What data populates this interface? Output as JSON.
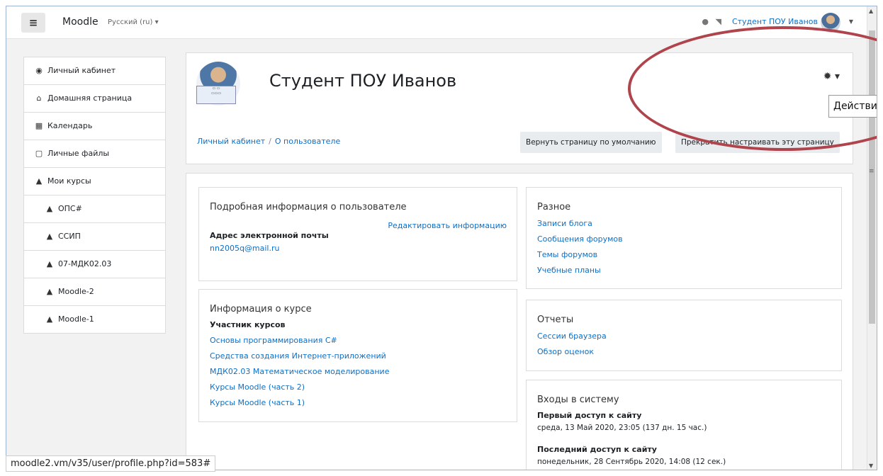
{
  "navbar": {
    "brand": "Moodle",
    "language": "Русский (ru) ▾",
    "user_name": "Студент ПОУ Иванов",
    "menu_icon": "hamburger-icon",
    "bell_icon": "bell-icon",
    "message_icon": "message-icon"
  },
  "drawer": {
    "items": [
      {
        "label": "Личный кабинет",
        "icon": "dashboard-icon",
        "glyph": "◉"
      },
      {
        "label": "Домашняя страница",
        "icon": "home-icon",
        "glyph": "⌂"
      },
      {
        "label": "Календарь",
        "icon": "calendar-icon",
        "glyph": "▦"
      },
      {
        "label": "Личные файлы",
        "icon": "file-icon",
        "glyph": "▢"
      },
      {
        "label": "Мои курсы",
        "icon": "graduation-cap-icon",
        "glyph": "▲"
      },
      {
        "label": "ОПС#",
        "icon": "graduation-cap-icon",
        "glyph": "▲"
      },
      {
        "label": "ССИП",
        "icon": "graduation-cap-icon",
        "glyph": "▲"
      },
      {
        "label": "07-МДК02.03",
        "icon": "graduation-cap-icon",
        "glyph": "▲"
      },
      {
        "label": "Moodle-2",
        "icon": "graduation-cap-icon",
        "glyph": "▲"
      },
      {
        "label": "Moodle-1",
        "icon": "graduation-cap-icon",
        "glyph": "▲"
      }
    ]
  },
  "header": {
    "full_name": "Студент ПОУ Иванов",
    "breadcrumb": [
      "Личный кабинет",
      "О пользователе"
    ],
    "reset_button": "Вернуть страницу по умолчанию",
    "stop_button": "Прекратить настраивать эту страницу",
    "actions_tooltip": "Действия"
  },
  "details": {
    "title": "Подробная информация о пользователе",
    "edit_link": "Редактировать информацию",
    "email_label": "Адрес электронной почты",
    "email": "nn2005q@mail.ru"
  },
  "courses": {
    "title": "Информация о курсе",
    "participant_label": "Участник курсов",
    "items": [
      "Основы программирования С#",
      "Средства создания Интернет-приложений",
      "МДК02.03 Математическое моделирование",
      "Курсы Moodle (часть 2)",
      "Курсы Moodle (часть 1)"
    ]
  },
  "misc": {
    "title": "Разное",
    "items": [
      "Записи блога",
      "Сообщения форумов",
      "Темы форумов",
      "Учебные планы"
    ]
  },
  "reports": {
    "title": "Отчеты",
    "items": [
      "Сессии браузера",
      "Обзор оценок"
    ]
  },
  "logins": {
    "title": "Входы в систему",
    "first_label": "Первый доступ к сайту",
    "first_value": "среда, 13 Май 2020, 23:05  (137 дн. 15 час.)",
    "last_label": "Последний доступ к сайту",
    "last_value": "понедельник, 28 Сентябрь 2020, 14:08  (12 сек.)"
  },
  "status_url": "moodle2.vm/v35/user/profile.php?id=583#",
  "colors": {
    "link": "#0f6fc5",
    "annotation": "#b0444c"
  }
}
